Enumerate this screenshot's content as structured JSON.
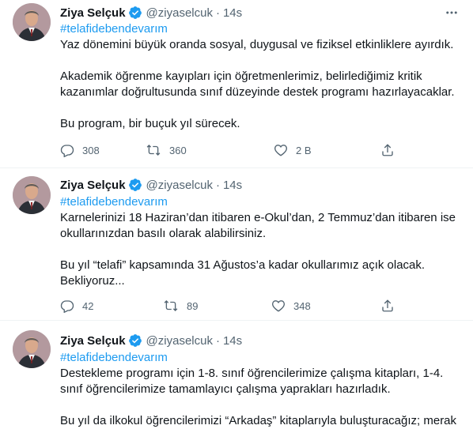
{
  "tweets": [
    {
      "name": "Ziya Selçuk",
      "handle": "@ziyaselcuk",
      "separator": "·",
      "time": "14s",
      "hashtag": "#telafidebendevarım",
      "paragraphs": [
        "Yaz dönemini büyük oranda sosyal, duygusal ve fiziksel etkinliklere ayırdık.",
        "Akademik öğrenme kayıpları için öğretmenlerimiz, belirlediğimiz kritik kazanımlar doğrultusunda sınıf düzeyinde destek programı hazırlayacaklar.",
        "Bu program, bir buçuk yıl sürecek."
      ],
      "replies": "308",
      "retweets": "360",
      "likes": "2 B"
    },
    {
      "name": "Ziya Selçuk",
      "handle": "@ziyaselcuk",
      "separator": "·",
      "time": "14s",
      "hashtag": "#telafidebendevarım",
      "paragraphs": [
        "Karnelerinizi 18 Haziran’dan itibaren e-Okul’dan, 2 Temmuz’dan itibaren ise okullarınızdan basılı olarak alabilirsiniz.",
        "Bu yıl “telafi” kapsamında 31 Ağustos’a kadar okullarımız açık olacak. Bekliyoruz..."
      ],
      "replies": "42",
      "retweets": "89",
      "likes": "348"
    },
    {
      "name": "Ziya Selçuk",
      "handle": "@ziyaselcuk",
      "separator": "·",
      "time": "14s",
      "hashtag": "#telafidebendevarım",
      "paragraphs": [
        "Destekleme programı için 1-8. sınıf öğrencilerimize çalışma kitapları, 1-4. sınıf öğrencilerimize tamamlayıcı çalışma yaprakları hazırladık.",
        "Bu yıl da ilkokul öğrencilerimizi “Arkadaş” kitaplarıyla buluşturacağız; merak"
      ]
    }
  ],
  "colors": {
    "link": "#1d9bf0",
    "muted": "#536471",
    "text": "#0f1419"
  },
  "icons": [
    "more-icon",
    "verified-badge-icon",
    "reply-icon",
    "retweet-icon",
    "like-icon",
    "share-icon"
  ]
}
